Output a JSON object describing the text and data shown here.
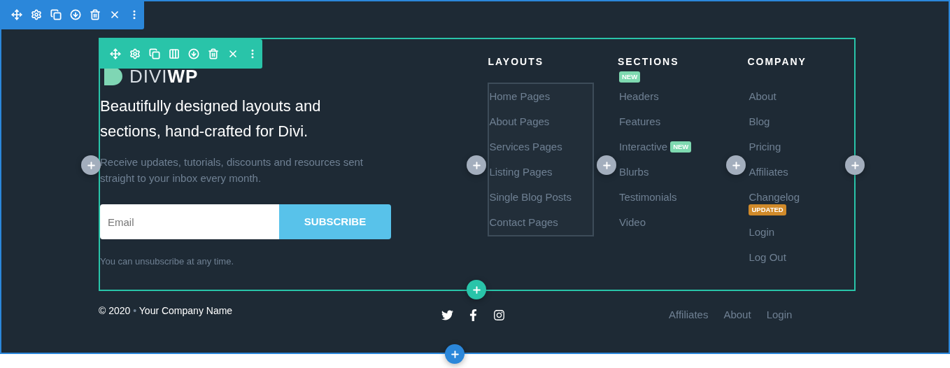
{
  "logo": {
    "light": "DIVI",
    "bold": "WP"
  },
  "headline": "Beautifully designed layouts and sections, hand-crafted for Divi.",
  "description": "Receive updates, tutorials, discounts and resources sent straight to your inbox every month.",
  "email_field": {
    "placeholder": "Email"
  },
  "subscribe_button": "SUBSCRIBE",
  "note": "You can unsubscribe at any time.",
  "menus": [
    {
      "heading": "LAYOUTS",
      "outlined": true,
      "links": [
        {
          "label": "Home Pages"
        },
        {
          "label": "About Pages"
        },
        {
          "label": "Services Pages"
        },
        {
          "label": "Listing Pages"
        },
        {
          "label": "Single Blog Posts"
        },
        {
          "label": "Contact Pages"
        }
      ]
    },
    {
      "heading": "SECTIONS",
      "outlined": false,
      "links": [
        {
          "label": "Headers",
          "badge": {
            "text": "NEW",
            "kind": "above",
            "color": "#7ed9b0"
          }
        },
        {
          "label": "Features"
        },
        {
          "label": "Interactive",
          "badge": {
            "text": "NEW",
            "kind": "inline",
            "color": "#7ed9b0"
          }
        },
        {
          "label": "Blurbs"
        },
        {
          "label": "Testimonials"
        },
        {
          "label": "Video"
        }
      ]
    },
    {
      "heading": "COMPANY",
      "outlined": false,
      "links": [
        {
          "label": "About"
        },
        {
          "label": "Blog"
        },
        {
          "label": "Pricing"
        },
        {
          "label": "Affiliates"
        },
        {
          "label": "Changelog",
          "badge": {
            "text": "UPDATED",
            "kind": "below",
            "color": "#d08a2a"
          }
        },
        {
          "label": "Login"
        },
        {
          "label": "Log Out"
        }
      ]
    }
  ],
  "footer": {
    "year": "© 2020",
    "separator": "•",
    "company": "Your Company Name",
    "social": [
      {
        "kind": "twitter"
      },
      {
        "kind": "facebook"
      },
      {
        "kind": "instagram"
      }
    ],
    "links": [
      "Affiliates",
      "About",
      "Login"
    ]
  }
}
